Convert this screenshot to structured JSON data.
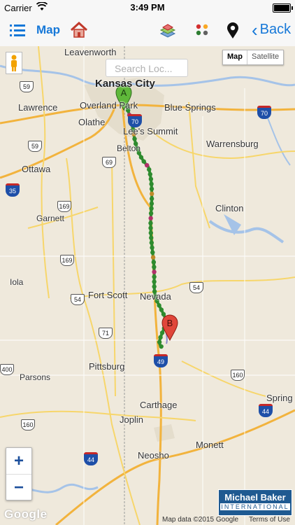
{
  "status_bar": {
    "carrier": "Carrier",
    "time": "3:49 PM",
    "battery_level": 1.0
  },
  "nav": {
    "title": "Map",
    "back_label": "Back",
    "icons": [
      "list-icon",
      "home-icon",
      "layers-icon",
      "traffic-light-icon",
      "location-pin-icon",
      "chevron-left-icon"
    ]
  },
  "map": {
    "map_type": {
      "map": "Map",
      "satellite": "Satellite",
      "selected": "Map"
    },
    "search_placeholder": "Search Loc...",
    "markers": {
      "start": "A",
      "end": "B"
    },
    "zoom": {
      "in": "+",
      "out": "−"
    },
    "google": "Google",
    "attribution": "Map data ©2015 Google",
    "terms": "Terms of Use",
    "logo": {
      "line1": "Michael Baker",
      "line2": "INTERNATIONAL"
    },
    "route_colors": {
      "route": "#2e8b2e",
      "alt": "#8a8acb",
      "marker_start": "#5fb83a",
      "marker_end": "#e0463a"
    },
    "places": {
      "leavenworth": "Leavenworth",
      "kansas_city": "Kansas City",
      "overland_park": "Overland Park",
      "lawrence": "Lawrence",
      "olathe": "Olathe",
      "lees_summit": "Lee's Summit",
      "blue_springs": "Blue Springs",
      "belton": "Belton",
      "warrensburg": "Warrensburg",
      "ottawa": "Ottawa",
      "garnett": "Garnett",
      "clinton": "Clinton",
      "iola": "Iola",
      "fort_scott": "Fort Scott",
      "nevada": "Nevada",
      "pittsburg": "Pittsburg",
      "parsons": "Parsons",
      "carthage": "Carthage",
      "joplin": "Joplin",
      "neosho": "Neosho",
      "monett": "Monett",
      "springfield": "Spring"
    },
    "shields": {
      "i70": "70",
      "i70b": "70",
      "i35": "35",
      "i49": "49",
      "i44": "44",
      "i44b": "44",
      "us59": "59",
      "us59b": "59",
      "us169": "169",
      "us169b": "169",
      "us69": "69",
      "us54": "54",
      "us54b": "54",
      "us400": "400",
      "us160": "160",
      "us160b": "160",
      "us71": "71"
    }
  }
}
